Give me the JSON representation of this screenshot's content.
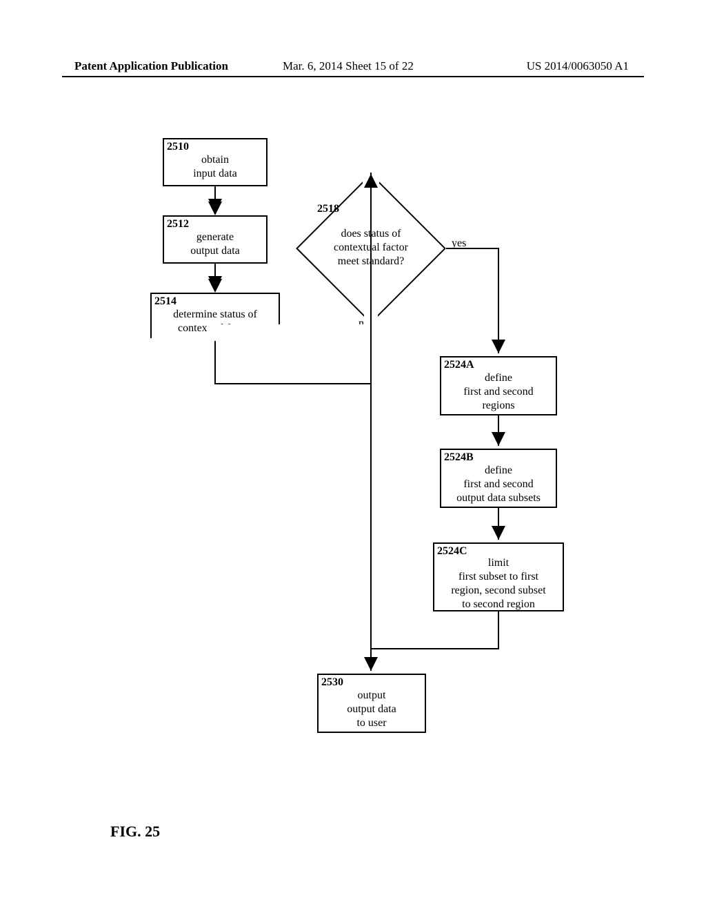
{
  "header": {
    "left": "Patent Application Publication",
    "middle": "Mar. 6, 2014  Sheet 15 of 22",
    "right": "US 2014/0063050 A1"
  },
  "figure_label": "FIG. 25",
  "boxes": {
    "b2510": {
      "ref": "2510",
      "text": "obtain\ninput data"
    },
    "b2512": {
      "ref": "2512",
      "text": "generate\noutput data"
    },
    "b2514": {
      "ref": "2514",
      "text": "determine status of\ncontextual factor"
    },
    "b2524A": {
      "ref": "2524A",
      "text": "define\nfirst and second\nregions"
    },
    "b2524B": {
      "ref": "2524B",
      "text": "define\nfirst and second\noutput data subsets"
    },
    "b2524C": {
      "ref": "2524C",
      "text": "limit\nfirst subset to first\nregion, second subset\nto second region"
    },
    "b2530": {
      "ref": "2530",
      "text": "output\noutput data\nto user"
    }
  },
  "decision": {
    "ref": "2518",
    "text": "does status of\ncontextual factor\nmeet standard?",
    "yes": "yes",
    "no": "no"
  }
}
